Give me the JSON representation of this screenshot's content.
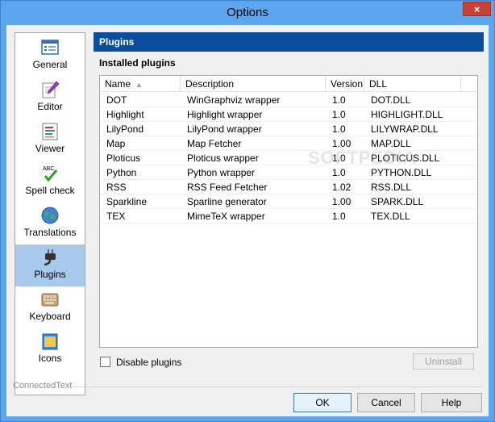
{
  "window": {
    "title": "Options",
    "close_glyph": "×"
  },
  "nav": {
    "items": [
      {
        "label": "General",
        "icon": "general-window-icon"
      },
      {
        "label": "Editor",
        "icon": "editor-pen-icon"
      },
      {
        "label": "Viewer",
        "icon": "viewer-document-icon"
      },
      {
        "label": "Spell check",
        "icon": "spellcheck-abc-icon"
      },
      {
        "label": "Translations",
        "icon": "globe-icon"
      },
      {
        "label": "Plugins",
        "icon": "plug-icon"
      },
      {
        "label": "Keyboard",
        "icon": "keyboard-icon"
      },
      {
        "label": "Icons",
        "icon": "icons-folder-icon"
      }
    ],
    "selected": "Plugins"
  },
  "panel": {
    "header": "Plugins",
    "section_title": "Installed plugins"
  },
  "table": {
    "columns": [
      "Name",
      "Description",
      "Version",
      "DLL"
    ],
    "sorted_by": "Name",
    "rows": [
      {
        "name": "DOT",
        "description": "WinGraphviz wrapper",
        "version": "1.0",
        "dll": "DOT.DLL"
      },
      {
        "name": "Highlight",
        "description": "Highlight wrapper",
        "version": "1.0",
        "dll": "HIGHLIGHT.DLL"
      },
      {
        "name": "LilyPond",
        "description": "LilyPond wrapper",
        "version": "1.0",
        "dll": "LILYWRAP.DLL"
      },
      {
        "name": "Map",
        "description": "Map Fetcher",
        "version": "1.00",
        "dll": "MAP.DLL"
      },
      {
        "name": "Ploticus",
        "description": "Ploticus wrapper",
        "version": "1.0",
        "dll": "PLOTICUS.DLL"
      },
      {
        "name": "Python",
        "description": "Python wrapper",
        "version": "1.0",
        "dll": "PYTHON.DLL"
      },
      {
        "name": "RSS",
        "description": "RSS Feed Fetcher",
        "version": "1.02",
        "dll": "RSS.DLL"
      },
      {
        "name": "Sparkline",
        "description": "Sparline generator",
        "version": "1.00",
        "dll": "SPARK.DLL"
      },
      {
        "name": "TEX",
        "description": "MimeTeX wrapper",
        "version": "1.0",
        "dll": "TEX.DLL"
      }
    ]
  },
  "options": {
    "disable_plugins_label": "Disable plugins",
    "disable_plugins_checked": false,
    "uninstall_label": "Uninstall"
  },
  "footer": {
    "app_name": "ConnectedText",
    "ok_label": "OK",
    "cancel_label": "Cancel",
    "help_label": "Help"
  },
  "watermark": "SOFTPEDIA",
  "colors": {
    "title_bar": "#5ca6ee",
    "panel_header": "#0b4f9c",
    "selected_nav": "#a9c9ec",
    "close_button": "#c7433a"
  }
}
